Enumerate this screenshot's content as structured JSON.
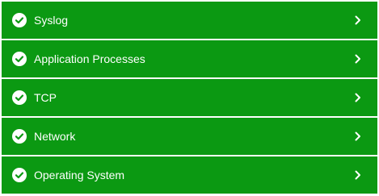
{
  "colors": {
    "row_background": "#0b9912",
    "text": "#ffffff",
    "page_background": "#ffffff"
  },
  "items": [
    {
      "label": "Syslog",
      "status_icon": "check-circle-icon",
      "expand_icon": "chevron-right-icon"
    },
    {
      "label": "Application Processes",
      "status_icon": "check-circle-icon",
      "expand_icon": "chevron-right-icon"
    },
    {
      "label": "TCP",
      "status_icon": "check-circle-icon",
      "expand_icon": "chevron-right-icon"
    },
    {
      "label": "Network",
      "status_icon": "check-circle-icon",
      "expand_icon": "chevron-right-icon"
    },
    {
      "label": "Operating System",
      "status_icon": "check-circle-icon",
      "expand_icon": "chevron-right-icon"
    }
  ]
}
